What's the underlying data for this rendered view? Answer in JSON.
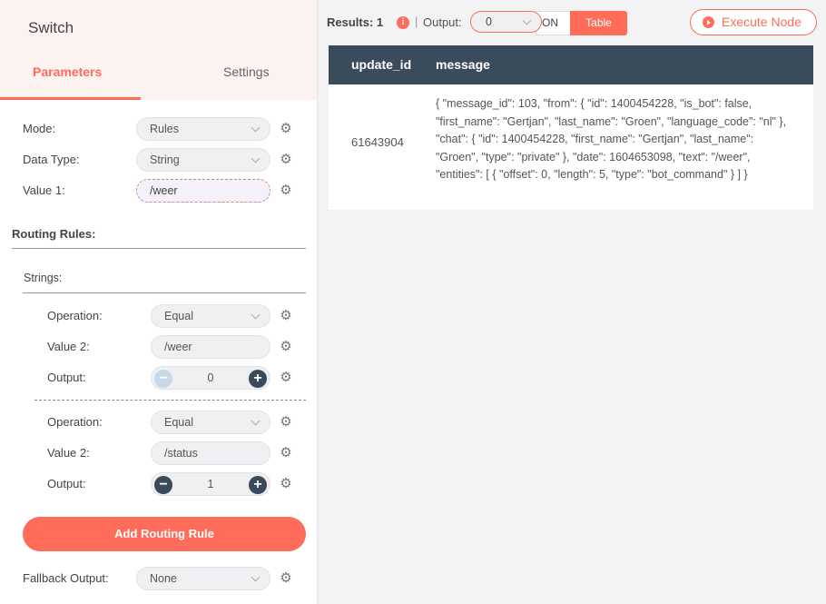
{
  "node": {
    "title": "Switch"
  },
  "tabs": {
    "parameters": "Parameters",
    "settings": "Settings"
  },
  "params": {
    "mode": {
      "label": "Mode:",
      "value": "Rules"
    },
    "data_type": {
      "label": "Data Type:",
      "value": "String"
    },
    "value1": {
      "label": "Value 1:",
      "value": "/weer"
    }
  },
  "routing": {
    "title": "Routing Rules:",
    "strings_label": "Strings:",
    "rules": [
      {
        "operation_label": "Operation:",
        "operation": "Equal",
        "value2_label": "Value 2:",
        "value2": "/weer",
        "output_label": "Output:",
        "output": "0"
      },
      {
        "operation_label": "Operation:",
        "operation": "Equal",
        "value2_label": "Value 2:",
        "value2": "/status",
        "output_label": "Output:",
        "output": "1"
      }
    ],
    "add_button": "Add Routing Rule"
  },
  "fallback": {
    "label": "Fallback Output:",
    "value": "None"
  },
  "results": {
    "label": "Results: 1",
    "separator": "|",
    "output_label": "Output:",
    "output_value": "0",
    "json_label": "ON",
    "table_label": "Table",
    "execute_label": "Execute Node"
  },
  "table": {
    "headers": [
      "update_id",
      "message"
    ],
    "rows": [
      {
        "update_id": "61643904",
        "message": "{ \"message_id\": 103, \"from\": { \"id\": 1400454228, \"is_bot\": false, \"first_name\": \"Gertjan\", \"last_name\": \"Groen\", \"language_code\": \"nl\" }, \"chat\": { \"id\": 1400454228, \"first_name\": \"Gertjan\", \"last_name\": \"Groen\", \"type\": \"private\" }, \"date\": 1604653098, \"text\": \"/weer\", \"entities\": [ { \"offset\": 0, \"length\": 5, \"type\": \"bot_command\" } ] }"
      }
    ]
  },
  "colors": {
    "accent": "#ff6d5a",
    "header": "#3a4b5c"
  }
}
